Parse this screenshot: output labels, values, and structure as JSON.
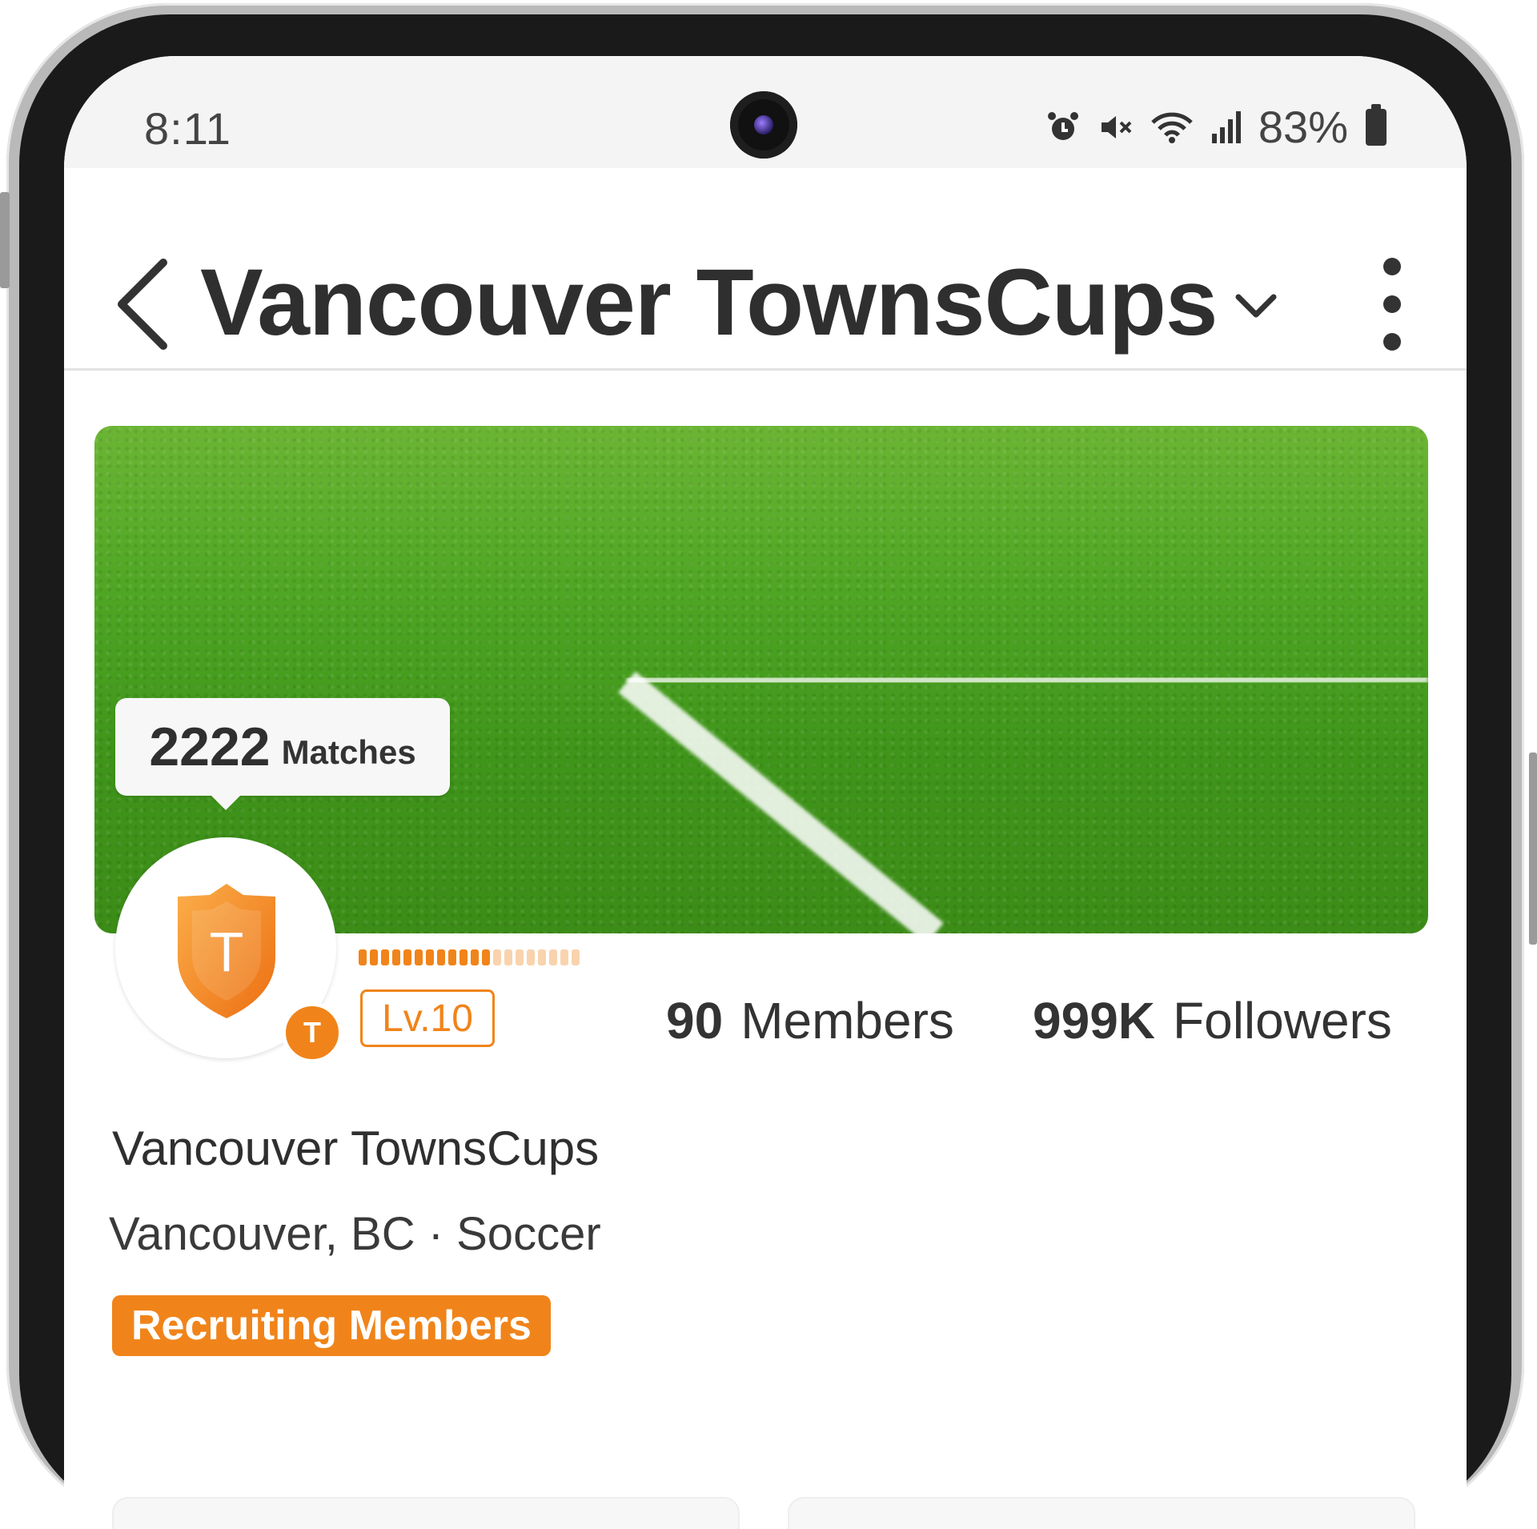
{
  "status_bar": {
    "time": "8:11",
    "battery": "83%",
    "icons": [
      "alarm-icon",
      "mute-icon",
      "wifi-icon",
      "signal-icon",
      "battery-icon"
    ]
  },
  "header": {
    "title": "Vancouver TownsCups",
    "back_icon": "back-arrow-icon",
    "dropdown_icon": "chevron-down-icon",
    "menu_icon": "more-vertical-icon"
  },
  "banner": {
    "image": "soccer-field-grass"
  },
  "team": {
    "matches_count": "2222",
    "matches_label": "Matches",
    "avatar_letter": "T",
    "sub_badge_letter": "T",
    "level": "Lv.10",
    "level_progress": 0.6,
    "members_count": "90",
    "members_label": "Members",
    "followers_count": "999K",
    "followers_label": "Followers",
    "name": "Vancouver TownsCups",
    "meta": "Vancouver, BC · Soccer",
    "recruit_badge": "Recruiting Members"
  },
  "colors": {
    "accent": "#f0841a",
    "accent_light": "#f9d3ad",
    "text_dark": "#2f2f2f"
  }
}
